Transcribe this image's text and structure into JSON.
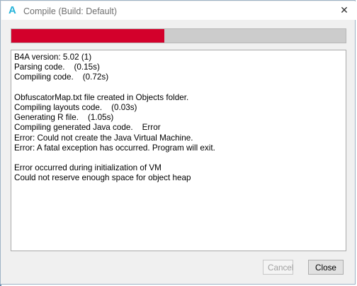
{
  "window": {
    "icon_glyph": "A",
    "title": "Compile (Build: Default)",
    "close_glyph": "✕"
  },
  "progress": {
    "fraction": 0.458,
    "fill_color": "#d3002b",
    "track_color": "#cccccc"
  },
  "log": {
    "lines": [
      "B4A version: 5.02 (1)",
      "Parsing code.    (0.15s)",
      "Compiling code.    (0.72s)",
      "",
      "ObfuscatorMap.txt file created in Objects folder.",
      "Compiling layouts code.    (0.03s)",
      "Generating R file.    (1.05s)",
      "Compiling generated Java code.    Error",
      "Error: Could not create the Java Virtual Machine.",
      "Error: A fatal exception has occurred. Program will exit.",
      "",
      "Error occurred during initialization of VM",
      "Could not reserve enough space for object heap"
    ]
  },
  "buttons": {
    "cancel_label": "Cancel",
    "close_label": "Close"
  },
  "colors": {
    "accent_icon": "#25b3d9",
    "error_bar": "#d3002b"
  }
}
